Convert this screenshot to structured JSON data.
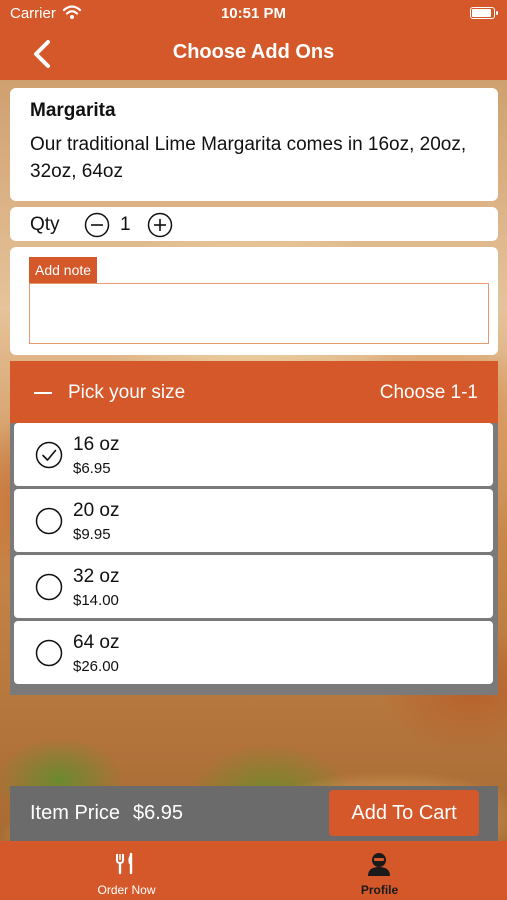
{
  "status_bar": {
    "carrier": "Carrier",
    "time": "10:51 PM",
    "wifi_icon": "wifi-icon",
    "battery_icon": "battery-icon"
  },
  "nav": {
    "title": "Choose Add Ons",
    "back_icon": "chevron-left-icon"
  },
  "item": {
    "name": "Margarita",
    "description": "Our traditional Lime Margarita comes in 16oz, 20oz, 32oz, 64oz"
  },
  "quantity": {
    "label": "Qty",
    "value": "1",
    "minus_icon": "minus-circle-icon",
    "plus_icon": "plus-circle-icon"
  },
  "note": {
    "label": "Add note",
    "value": "",
    "placeholder": ""
  },
  "addon_group": {
    "title": "Pick your size",
    "rule": "Choose 1-1",
    "options": [
      {
        "name": "16 oz",
        "price": "$6.95",
        "selected": true
      },
      {
        "name": "20 oz",
        "price": "$9.95",
        "selected": false
      },
      {
        "name": "32 oz",
        "price": "$14.00",
        "selected": false
      },
      {
        "name": "64 oz",
        "price": "$26.00",
        "selected": false
      }
    ]
  },
  "footer": {
    "price_label": "Item Price",
    "price_value": "$6.95",
    "add_button": "Add To Cart"
  },
  "tabs": [
    {
      "label": "Order Now",
      "icon": "utensils-icon",
      "active": false
    },
    {
      "label": "Profile",
      "icon": "person-icon",
      "active": true
    }
  ],
  "colors": {
    "brand": "#d4582a",
    "panel_gray": "#7a7a7a",
    "footer_gray": "#6b6b6b"
  }
}
